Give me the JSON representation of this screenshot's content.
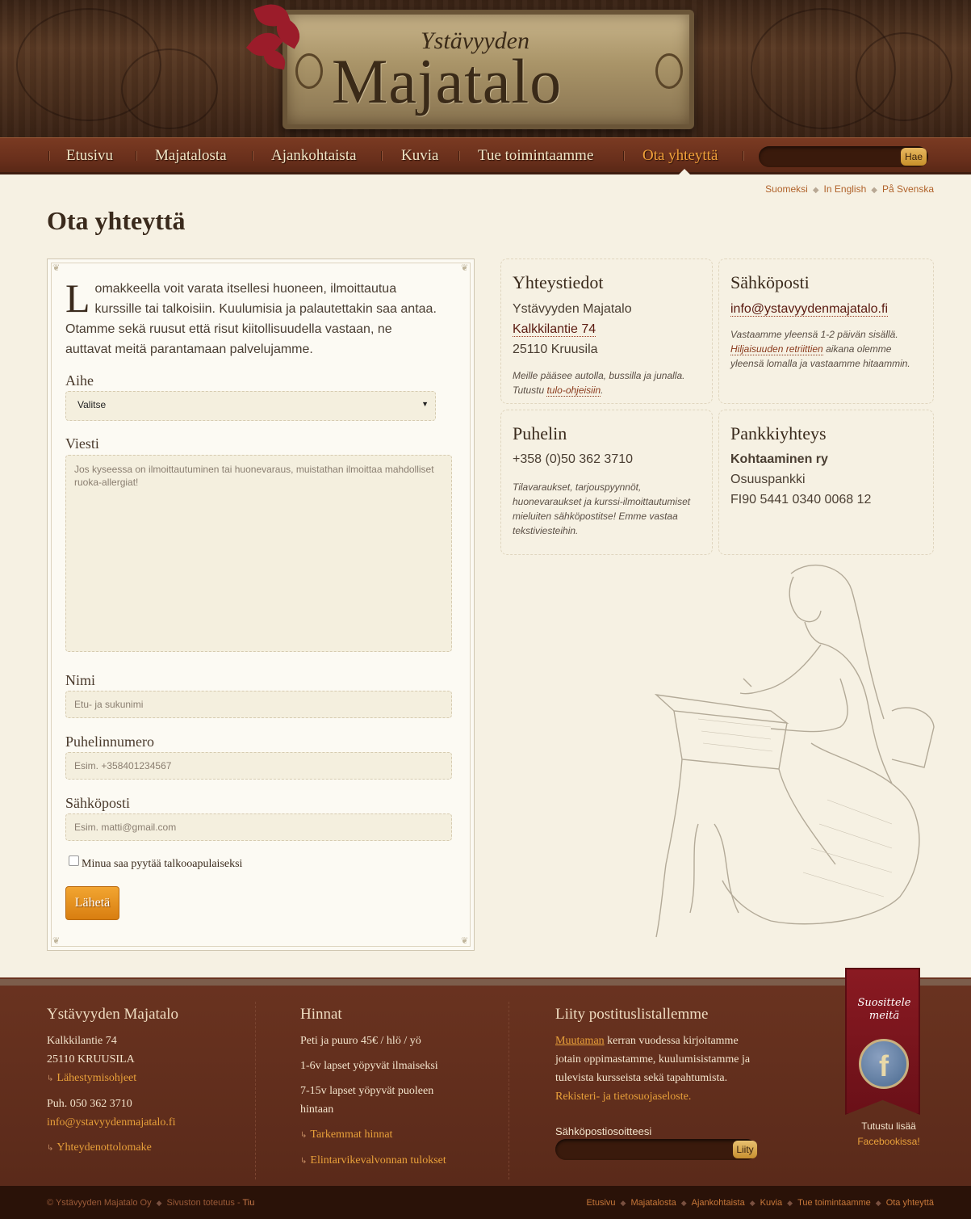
{
  "header": {
    "logo_small": "Ystävyyden",
    "logo_big": "Majatalo"
  },
  "nav": {
    "items": [
      {
        "label": "Etusivu"
      },
      {
        "label": "Majatalosta"
      },
      {
        "label": "Ajankohtaista"
      },
      {
        "label": "Kuvia"
      },
      {
        "label": "Tue toimintaamme"
      },
      {
        "label": "Ota yhteyttä",
        "active": true
      }
    ],
    "search_button": "Hae"
  },
  "languages": [
    "Suomeksi",
    "In English",
    "På Svenska"
  ],
  "page_title": "Ota yhteyttä",
  "form": {
    "intro_dropcap": "L",
    "intro_rest": "omakkeella voit varata itsellesi huoneen, ilmoittautua kurssille tai talkoisiin. Kuulumisia ja palautettakin saa antaa. Otamme sekä ruusut että risut kiitollisuudella vastaan, ne auttavat meitä parantamaan palvelujamme.",
    "subject_label": "Aihe",
    "subject_value": "Valitse",
    "message_label": "Viesti",
    "message_placeholder": "Jos kyseessa on ilmoittautuminen tai huonevaraus, muistathan ilmoittaa mahdolliset ruoka-allergiat!",
    "name_label": "Nimi",
    "name_placeholder": "Etu- ja sukunimi",
    "phone_label": "Puhelinnumero",
    "phone_placeholder": "Esim. +358401234567",
    "email_label": "Sähköposti",
    "email_placeholder": "Esim. matti@gmail.com",
    "checkbox_label": "Minua saa pyytää talkooapulaiseksi",
    "checkbox_checked": false,
    "submit_label": "Lähetä"
  },
  "contact": {
    "title": "Yhteystiedot",
    "org": "Ystävyyden Majatalo",
    "street": "Kalkkilantie 74",
    "city": "25110 Kruusila",
    "note_line1": "Meille pääsee autolla, bussilla ja junalla.",
    "note_prefix": "Tutustu ",
    "note_link": "tulo-ohjeisiin",
    "note_suffix": "."
  },
  "email_card": {
    "title": "Sähköposti",
    "address": "info@ystavyydenmajatalo.fi",
    "note_line1": "Vastaamme yleensä 1-2 päivän sisällä.",
    "note_link": "Hiljaisuuden retriittien",
    "note_rest1": " aikana olemme",
    "note_line3": "yleensä lomalla ja vastaamme hitaammin."
  },
  "phone_card": {
    "title": "Puhelin",
    "number": "+358 (0)50 362 3710",
    "note_line1": "Tilavaraukset, tarjouspyynnöt,",
    "note_line2": "huonevaraukset ja kurssi-ilmoittautumiset",
    "note_line3": "mieluiten sähköpostitse! Emme vastaa",
    "note_line4": "tekstiviesteihin."
  },
  "bank_card": {
    "title": "Pankkiyhteys",
    "holder": "Kohtaaminen ry",
    "bank": "Osuuspankki",
    "iban": "FI90 5441 0340 0068 12"
  },
  "footer": {
    "col1": {
      "title": "Ystävyyden Majatalo",
      "street": "Kalkkilantie 74",
      "city": "25110 KRUUSILA",
      "directions": "Lähestymisohjeet",
      "phone": "Puh. 050 362 3710",
      "email": "info@ystavyydenmajatalo.fi",
      "contact_form": "Yhteydenottolomake"
    },
    "col2": {
      "title": "Hinnat",
      "line1": "Peti ja puuro 45€ / hlö / yö",
      "line2": "1-6v lapset yöpyvät ilmaiseksi",
      "line3a": "7-15v lapset yöpyvät puoleen",
      "line3b": "hintaan",
      "link1": "Tarkemmat hinnat",
      "link2": "Elintarvikevalvonnan tulokset"
    },
    "col3": {
      "title": "Liity postituslistallemme",
      "link_word": "Muutaman",
      "text1": " kerran vuodessa kirjoitamme",
      "text2": "jotain oppimastamme, kuulumisistamme ja",
      "text3": "tulevista kursseista sekä tapahtumista.",
      "privacy": "Rekisteri- ja tietosuojaseloste.",
      "email_label": "Sähköpostiosoitteesi",
      "join_button": "Liity"
    },
    "ribbon": {
      "line1": "Suosittele",
      "line2": "meitä",
      "more_text": "Tutustu lisää",
      "more_link": "Facebookissa!"
    }
  },
  "bottom_bar": {
    "copyright": "© Ystävyyden Majatalo Oy",
    "credit_prefix": "Sivuston toteutus - ",
    "credit_name": "Tiu",
    "links": [
      "Etusivu",
      "Majatalosta",
      "Ajankohtaista",
      "Kuvia",
      "Tue toimintaamme",
      "Ota yhteyttä"
    ]
  },
  "colors": {
    "accent": "#f0a03a",
    "nav_bg": "#6a301c",
    "page_bg": "#f6f1e3",
    "footer_bg": "#5a2a1a",
    "button": "#e0901e"
  }
}
